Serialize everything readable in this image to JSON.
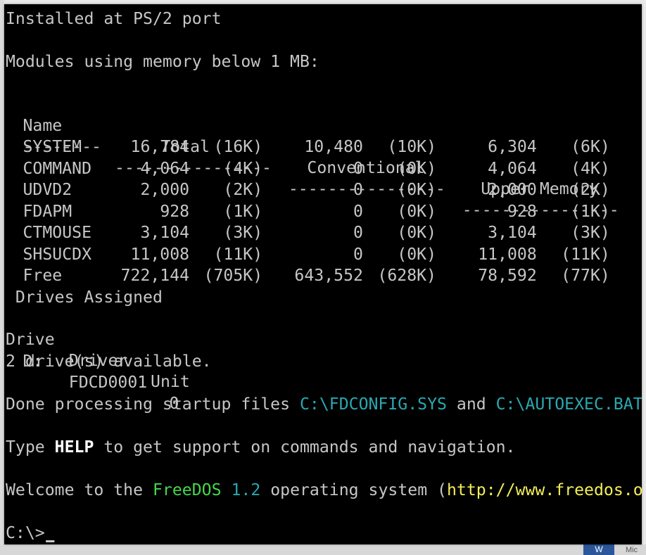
{
  "console": {
    "line_ps2": "Installed at PS/2 port",
    "line_modules": "Modules using memory below 1 MB:",
    "table": {
      "headers": [
        "Name",
        "Total",
        "Conventional",
        "Upper Memory"
      ],
      "separators": [
        "--------",
        "----------------",
        "----------------",
        "----------------"
      ],
      "rows": [
        {
          "name": "SYSTEM",
          "total": "16,784",
          "total_k": "(16K)",
          "conv": "10,480",
          "conv_k": "(10K)",
          "upper": "6,304",
          "upper_k": "(6K)"
        },
        {
          "name": "COMMAND",
          "total": "4,064",
          "total_k": "(4K)",
          "conv": "0",
          "conv_k": "(0K)",
          "upper": "4,064",
          "upper_k": "(4K)"
        },
        {
          "name": "UDVD2",
          "total": "2,000",
          "total_k": "(2K)",
          "conv": "0",
          "conv_k": "(0K)",
          "upper": "2,000",
          "upper_k": "(2K)"
        },
        {
          "name": "FDAPM",
          "total": "928",
          "total_k": "(1K)",
          "conv": "0",
          "conv_k": "(0K)",
          "upper": "928",
          "upper_k": "(1K)"
        },
        {
          "name": "CTMOUSE",
          "total": "3,104",
          "total_k": "(3K)",
          "conv": "0",
          "conv_k": "(0K)",
          "upper": "3,104",
          "upper_k": "(3K)"
        },
        {
          "name": "SHSUCDX",
          "total": "11,008",
          "total_k": "(11K)",
          "conv": "0",
          "conv_k": "(0K)",
          "upper": "11,008",
          "upper_k": "(11K)"
        },
        {
          "name": "Free",
          "total": "722,144",
          "total_k": "(705K)",
          "conv": "643,552",
          "conv_k": "(628K)",
          "upper": "78,592",
          "upper_k": "(77K)"
        }
      ]
    },
    "line_drives_assigned": " Drives Assigned",
    "drives_header": [
      "Drive",
      "Driver",
      "Unit"
    ],
    "drives_row": [
      "D:",
      "FDCD0001",
      "0"
    ],
    "line_drives_available": "2 drive(s) available.",
    "done_text": "Done processing startup files ",
    "done_file1": "C:\\FDCONFIG.SYS",
    "done_and": " and ",
    "done_file2": "C:\\AUTOEXEC.BAT",
    "type_text1": "Type ",
    "type_help": "HELP",
    "type_text2": " to get support on commands and navigation.",
    "welcome_text1": "Welcome to the ",
    "welcome_freedos": "FreeDOS",
    "welcome_version": "1.2",
    "welcome_text2": " operating system (",
    "welcome_url": "http://www.freedos.org",
    "welcome_close": ")",
    "prompt": "C:\\>"
  },
  "taskbar": {
    "word_icon_label": "W",
    "label": "Mic"
  },
  "colors": {
    "console_bg": "#000000",
    "console_text": "#c6c6c6",
    "cyan": "#2aa8b0",
    "green": "#47d64a",
    "yellow": "#f2ee5a"
  }
}
